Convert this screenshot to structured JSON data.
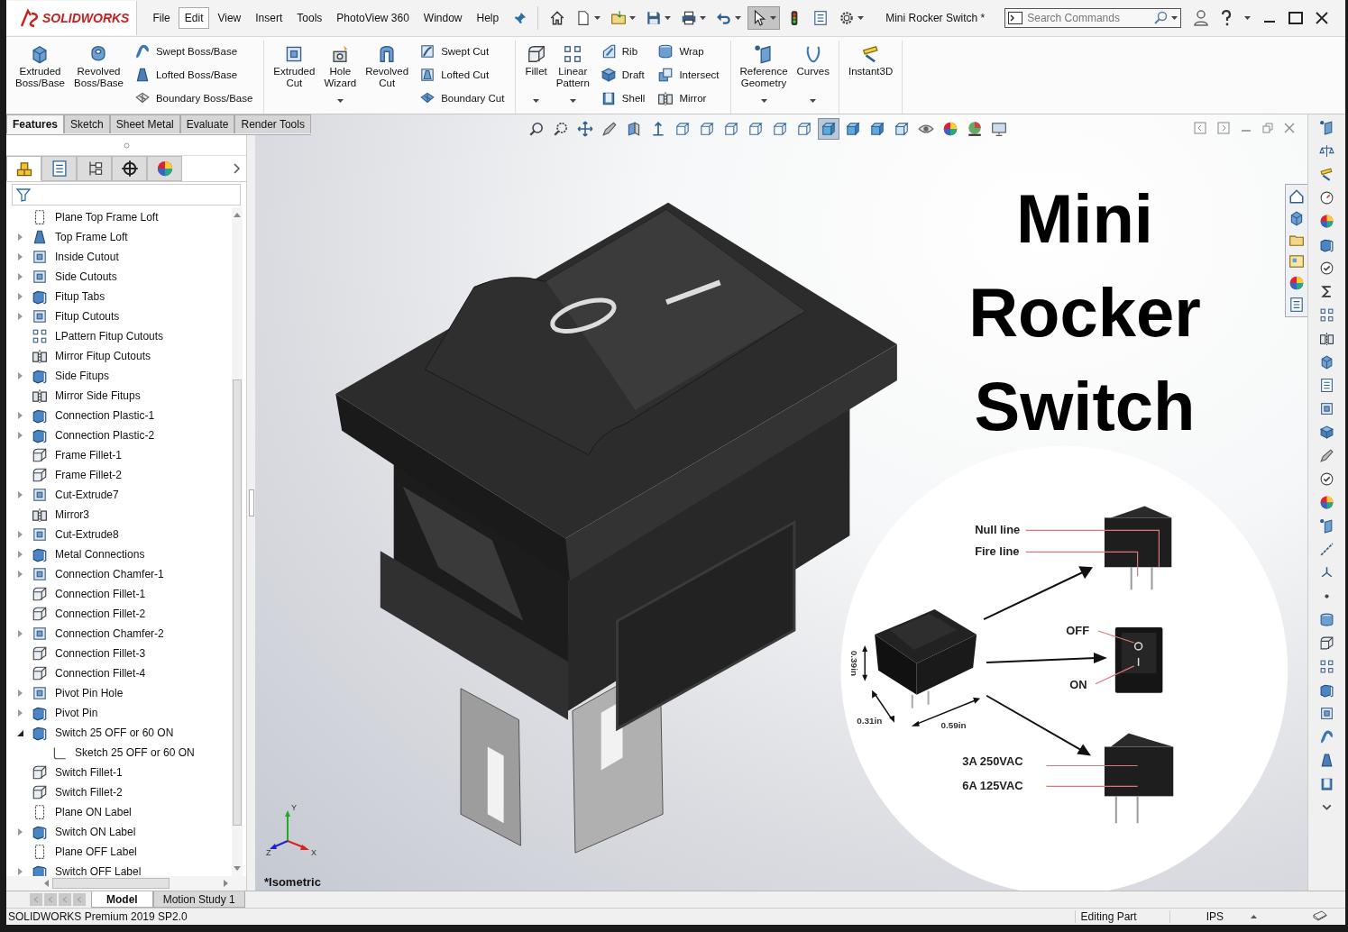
{
  "logo": "SOLIDWORKS",
  "menu": [
    {
      "label": "File",
      "selected": false
    },
    {
      "label": "Edit",
      "selected": true
    },
    {
      "label": "View",
      "selected": false
    },
    {
      "label": "Insert",
      "selected": false
    },
    {
      "label": "Tools",
      "selected": false
    },
    {
      "label": "PhotoView 360",
      "selected": false
    },
    {
      "label": "Window",
      "selected": false
    },
    {
      "label": "Help",
      "selected": false
    }
  ],
  "quick_access": [
    {
      "dropdown": false,
      "selected": false
    },
    {
      "dropdown": true,
      "selected": false
    },
    {
      "dropdown": true,
      "selected": false
    },
    {
      "dropdown": true,
      "selected": false
    },
    {
      "dropdown": true,
      "selected": false
    },
    {
      "dropdown": true,
      "selected": false
    },
    {
      "dropdown": true,
      "selected": true
    },
    {
      "dropdown": false,
      "selected": false
    },
    {
      "dropdown": false,
      "selected": false
    },
    {
      "dropdown": true,
      "selected": false
    }
  ],
  "document_title": "Mini Rocker Switch *",
  "search": {
    "placeholder": "Search Commands"
  },
  "ribbon": [
    {
      "items": [
        {
          "kind": "large",
          "label": "Extruded Boss/Base",
          "dropdown": false
        },
        {
          "kind": "large",
          "label": "Revolved Boss/Base",
          "dropdown": false
        },
        {
          "kind": "stack",
          "entries": [
            {
              "label": "Swept Boss/Base"
            },
            {
              "label": "Lofted Boss/Base"
            },
            {
              "label": "Boundary Boss/Base"
            }
          ]
        }
      ]
    },
    {
      "items": [
        {
          "kind": "large",
          "label": "Extruded Cut",
          "dropdown": false
        },
        {
          "kind": "large",
          "label": "Hole Wizard",
          "dropdown": true
        },
        {
          "kind": "large",
          "label": "Revolved Cut",
          "dropdown": false
        },
        {
          "kind": "stack",
          "entries": [
            {
              "label": "Swept Cut"
            },
            {
              "label": "Lofted Cut"
            },
            {
              "label": "Boundary Cut"
            }
          ]
        }
      ]
    },
    {
      "items": [
        {
          "kind": "large",
          "label": "Fillet",
          "dropdown": true
        },
        {
          "kind": "large",
          "label": "Linear Pattern",
          "dropdown": true
        },
        {
          "kind": "stack",
          "entries": [
            {
              "label": "Rib"
            },
            {
              "label": "Draft"
            },
            {
              "label": "Shell"
            }
          ]
        },
        {
          "kind": "stack",
          "entries": [
            {
              "label": "Wrap"
            },
            {
              "label": "Intersect"
            },
            {
              "label": "Mirror"
            }
          ]
        }
      ]
    },
    {
      "items": [
        {
          "kind": "large",
          "label": "Reference Geometry",
          "dropdown": true
        },
        {
          "kind": "large",
          "label": "Curves",
          "dropdown": true
        }
      ]
    },
    {
      "items": [
        {
          "kind": "large",
          "label": "Instant3D",
          "dropdown": false
        }
      ]
    }
  ],
  "command_tabs": [
    {
      "label": "Features",
      "selected": true
    },
    {
      "label": "Sketch",
      "selected": false
    },
    {
      "label": "Sheet Metal",
      "selected": false
    },
    {
      "label": "Evaluate",
      "selected": false
    },
    {
      "label": "Render Tools",
      "selected": false
    }
  ],
  "panel_tabs": [
    {
      "selected": true
    },
    {
      "selected": false
    },
    {
      "selected": false
    },
    {
      "selected": false
    },
    {
      "selected": false
    }
  ],
  "tree": [
    {
      "label": "Plane Top Frame Loft",
      "kind": "plane"
    },
    {
      "label": "Top Frame Loft",
      "kind": "loft",
      "expanded": false
    },
    {
      "label": "Inside Cutout",
      "kind": "cut",
      "expanded": false
    },
    {
      "label": "Side Cutouts",
      "kind": "cut",
      "expanded": false
    },
    {
      "label": "Fitup Tabs",
      "kind": "boss",
      "expanded": false
    },
    {
      "label": "Fitup Cutouts",
      "kind": "cut",
      "expanded": false
    },
    {
      "label": "LPattern Fitup Cutouts",
      "kind": "pattern"
    },
    {
      "label": "Mirror Fitup Cutouts",
      "kind": "mirror"
    },
    {
      "label": "Side Fitups",
      "kind": "boss",
      "expanded": false
    },
    {
      "label": "Mirror Side Fitups",
      "kind": "mirror"
    },
    {
      "label": "Connection Plastic-1",
      "kind": "boss",
      "expanded": false
    },
    {
      "label": "Connection Plastic-2",
      "kind": "boss",
      "expanded": false
    },
    {
      "label": "Frame Fillet-1",
      "kind": "fillet"
    },
    {
      "label": "Frame Fillet-2",
      "kind": "fillet"
    },
    {
      "label": "Cut-Extrude7",
      "kind": "cut",
      "expanded": false
    },
    {
      "label": "Mirror3",
      "kind": "mirror"
    },
    {
      "label": "Cut-Extrude8",
      "kind": "cut",
      "expanded": false
    },
    {
      "label": "Metal Connections",
      "kind": "boss",
      "expanded": false
    },
    {
      "label": "Connection Chamfer-1",
      "kind": "cut",
      "expanded": false
    },
    {
      "label": "Connection Fillet-1",
      "kind": "fillet"
    },
    {
      "label": "Connection Fillet-2",
      "kind": "fillet"
    },
    {
      "label": "Connection Chamfer-2",
      "kind": "cut",
      "expanded": false
    },
    {
      "label": "Connection Fillet-3",
      "kind": "fillet"
    },
    {
      "label": "Connection Fillet-4",
      "kind": "fillet"
    },
    {
      "label": "Pivot Pin Hole",
      "kind": "cut",
      "expanded": false
    },
    {
      "label": "Pivot Pin",
      "kind": "boss",
      "expanded": false
    },
    {
      "label": "Switch 25 OFF or 60 ON",
      "kind": "boss",
      "expanded": true,
      "children": [
        {
          "label": "Sketch 25 OFF or 60 ON",
          "kind": "sketch"
        }
      ]
    },
    {
      "label": "Switch Fillet-1",
      "kind": "fillet"
    },
    {
      "label": "Switch Fillet-2",
      "kind": "fillet"
    },
    {
      "label": "Plane ON Label",
      "kind": "plane"
    },
    {
      "label": "Switch ON Label",
      "kind": "boss",
      "expanded": false
    },
    {
      "label": "Plane OFF Label",
      "kind": "plane"
    },
    {
      "label": "Switch OFF Label",
      "kind": "boss",
      "expanded": false
    }
  ],
  "view_toolbar": [
    {
      "selected": false
    },
    {
      "selected": false
    },
    {
      "selected": false
    },
    {
      "selected": false
    },
    {
      "selected": false
    },
    {
      "selected": false
    },
    {
      "selected": false
    },
    {
      "selected": false
    },
    {
      "selected": false
    },
    {
      "selected": false
    },
    {
      "selected": false
    },
    {
      "selected": false
    },
    {
      "selected": true
    },
    {
      "selected": false
    },
    {
      "selected": false
    },
    {
      "selected": false
    },
    {
      "selected": false
    },
    {
      "selected": false
    },
    {
      "selected": false
    },
    {
      "selected": false
    }
  ],
  "viewport": {
    "title_lines": [
      "Mini",
      "Rocker",
      "Switch"
    ],
    "view_name": "*Isometric",
    "axes": [
      "X",
      "Y",
      "Z"
    ],
    "inset_labels": [
      {
        "text": "Null line",
        "kind": "callout"
      },
      {
        "text": "Fire line",
        "kind": "callout"
      },
      {
        "text": "OFF",
        "kind": "callout"
      },
      {
        "text": "ON",
        "kind": "callout"
      },
      {
        "text": "0.39in",
        "kind": "dimension"
      },
      {
        "text": "0.31in",
        "kind": "dimension"
      },
      {
        "text": "0.59in",
        "kind": "dimension"
      },
      {
        "text": "3A  250VAC",
        "kind": "callout"
      },
      {
        "text": "6A  125VAC",
        "kind": "callout"
      }
    ]
  },
  "bottom_tabs": [
    {
      "label": "Model",
      "selected": true
    },
    {
      "label": "Motion Study 1",
      "selected": false
    }
  ],
  "status_bar": {
    "product": "SOLIDWORKS Premium 2019 SP2.0",
    "mode": "Editing Part",
    "units": "IPS"
  }
}
